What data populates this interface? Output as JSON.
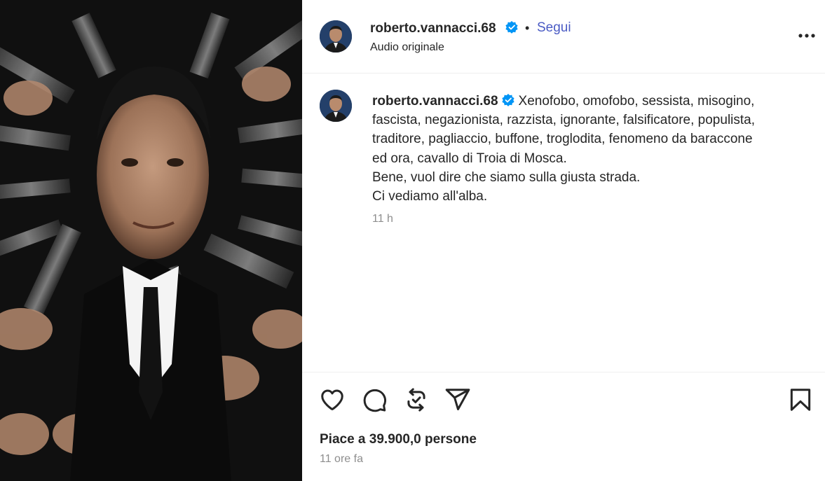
{
  "post": {
    "username": "roberto.vannacci.68",
    "follow_label": "Segui",
    "separator": "•",
    "audio_label": "Audio originale",
    "caption_lines": [
      "Xenofobo, omofobo, sessista, misogino,",
      "fascista, negazionista, razzista, ignorante, falsificatore, populista,",
      "traditore, pagliaccio, buffone, troglodita, fenomeno da baracconе",
      "ed ora, cavallo di Troia di Mosca.",
      "Bene, vuol dire che siamo sulla giusta strada.",
      "Ci vediamo all'alba."
    ],
    "caption_time": "11 h",
    "likes_text": "Piace a 39.900,0 persone",
    "posted_ago": "11 ore fa"
  },
  "icons": {
    "verified": "verified-badge-icon",
    "more": "more-options-icon",
    "like": "heart-icon",
    "comment": "comment-icon",
    "repost": "repost-icon",
    "share": "share-icon",
    "save": "bookmark-icon"
  },
  "colors": {
    "accent": "#4a5bc4",
    "verified": "#0095f6",
    "text": "#262626",
    "muted": "#8e8e8e"
  }
}
